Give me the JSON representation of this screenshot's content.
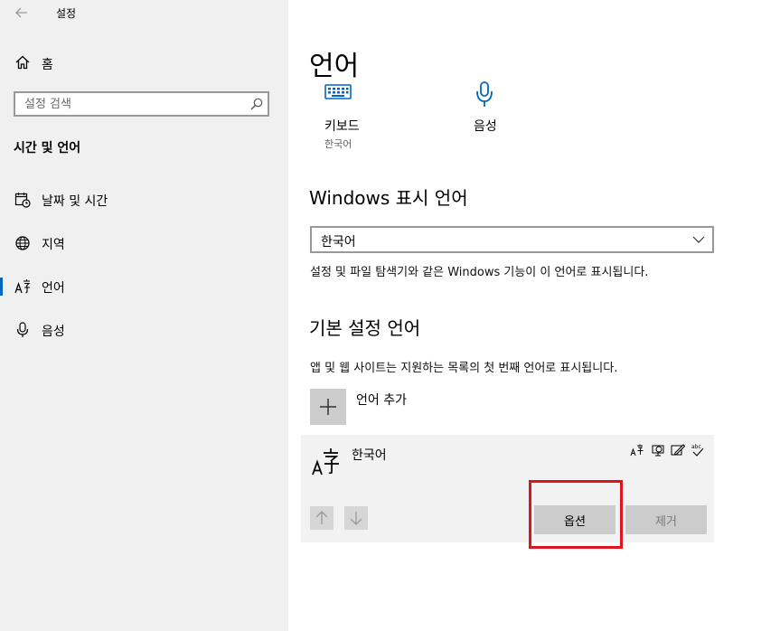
{
  "window": {
    "title": "설정"
  },
  "sidebar": {
    "home_label": "홈",
    "search": {
      "placeholder": "설정 검색"
    },
    "section_title": "시간 및 언어",
    "items": [
      {
        "label": "날짜 및 시간",
        "icon": "calendar-clock-icon"
      },
      {
        "label": "지역",
        "icon": "globe-icon"
      },
      {
        "label": "언어",
        "icon": "language-icon",
        "selected": true
      },
      {
        "label": "음성",
        "icon": "microphone-icon"
      }
    ]
  },
  "main": {
    "title": "언어",
    "shortcuts": [
      {
        "label": "키보드",
        "sub": "한국어",
        "icon": "keyboard-icon"
      },
      {
        "label": "음성",
        "sub": "",
        "icon": "microphone-icon"
      }
    ],
    "display_language": {
      "heading": "Windows 표시 언어",
      "selected": "한국어",
      "description": "설정 및 파일 탐색기와 같은 Windows 기능이 이 언어로 표시됩니다."
    },
    "preferred": {
      "heading": "기본 설정 언어",
      "description": "앱 및 웹 사이트는 지원하는 목록의 첫 번째 언어로 표시됩니다.",
      "add_label": "언어 추가",
      "languages": [
        {
          "name": "한국어",
          "features": [
            "display-language-icon",
            "speech-icon",
            "handwriting-icon",
            "spellcheck-icon"
          ],
          "options_label": "옵션",
          "remove_label": "제거"
        }
      ]
    }
  },
  "colors": {
    "accent": "#0067c0",
    "sidebar_bg": "#f0f0f0",
    "highlight": "#e0141e"
  }
}
